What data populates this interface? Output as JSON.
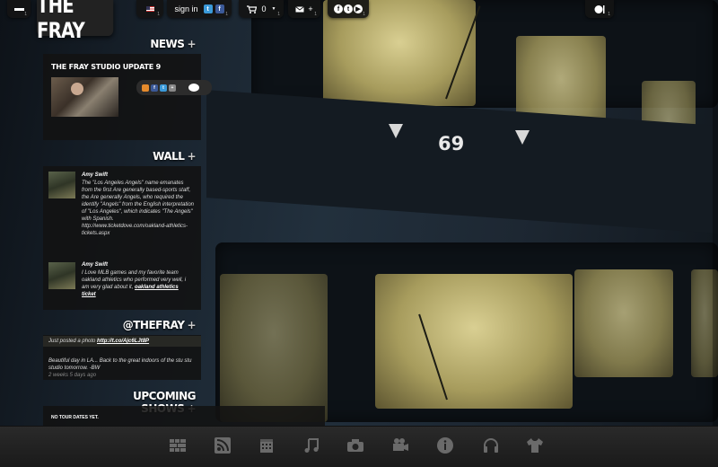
{
  "brand": {
    "logo_text": "THE FRAY"
  },
  "topbar": {
    "signin_label": "sign in",
    "cart_count": "0",
    "mail_plus": "+",
    "counts": {
      "menu": "1",
      "flag": "1",
      "signin": "1",
      "cart": "1",
      "mail": "1",
      "social": "1",
      "player": "1"
    },
    "icons": [
      "menu-icon",
      "flag-icon",
      "twitter-icon",
      "facebook-icon",
      "cart-icon",
      "mail-icon",
      "facebook-icon",
      "twitter-icon",
      "youtube-icon",
      "player-icon"
    ]
  },
  "news": {
    "heading": "NEWS",
    "plus": "+",
    "item_title": "THE FRAY STUDIO UPDATE 9"
  },
  "wall": {
    "heading": "WALL",
    "plus": "+",
    "posts": [
      {
        "author": "Amy Swift",
        "text": "The \"Los Angeles Angels\" name emanates from the first Are generally based-sports staff, the Are generally Angels, who required the identify \"Angels\" from the English interpretation of \"Los Angeles\", which indicates \"The Angels\" with Spanish. http://www.ticketdove.com/oakland-athletics-tickets.aspx",
        "link": ""
      },
      {
        "author": "Amy Swift",
        "text": "I Love MLB games and my favorite team oakland athletics who performed very well, i am very glad about it, ",
        "link": "oakland athletics ticket"
      }
    ]
  },
  "twitter": {
    "heading": "@THEFRAY",
    "plus": "+",
    "tweets": [
      {
        "text": "Just posted a photo ",
        "link": "http://t.co/Ajc6LJt8P",
        "time": ""
      },
      {
        "text": "Beautiful day in LA... Back to the great indoors of the stu stu studio tomorrow. -BW",
        "link": "",
        "time": "2 weeks 5 days ago"
      }
    ]
  },
  "shows": {
    "heading": "UPCOMING SHOWS",
    "plus": "+",
    "empty_text": "NO TOUR DATES YET."
  },
  "background": {
    "meter_label": "69"
  },
  "dock": {
    "icons": [
      "wall-grid-icon",
      "rss-icon",
      "calendar-icon",
      "music-note-icon",
      "camera-icon",
      "video-camera-icon",
      "info-icon",
      "headphones-icon",
      "tshirt-icon"
    ]
  },
  "colors": {
    "twitter": "#3b9ad9",
    "facebook": "#3b5998",
    "rss": "#e58a2c",
    "meter": "#d9cf92"
  }
}
